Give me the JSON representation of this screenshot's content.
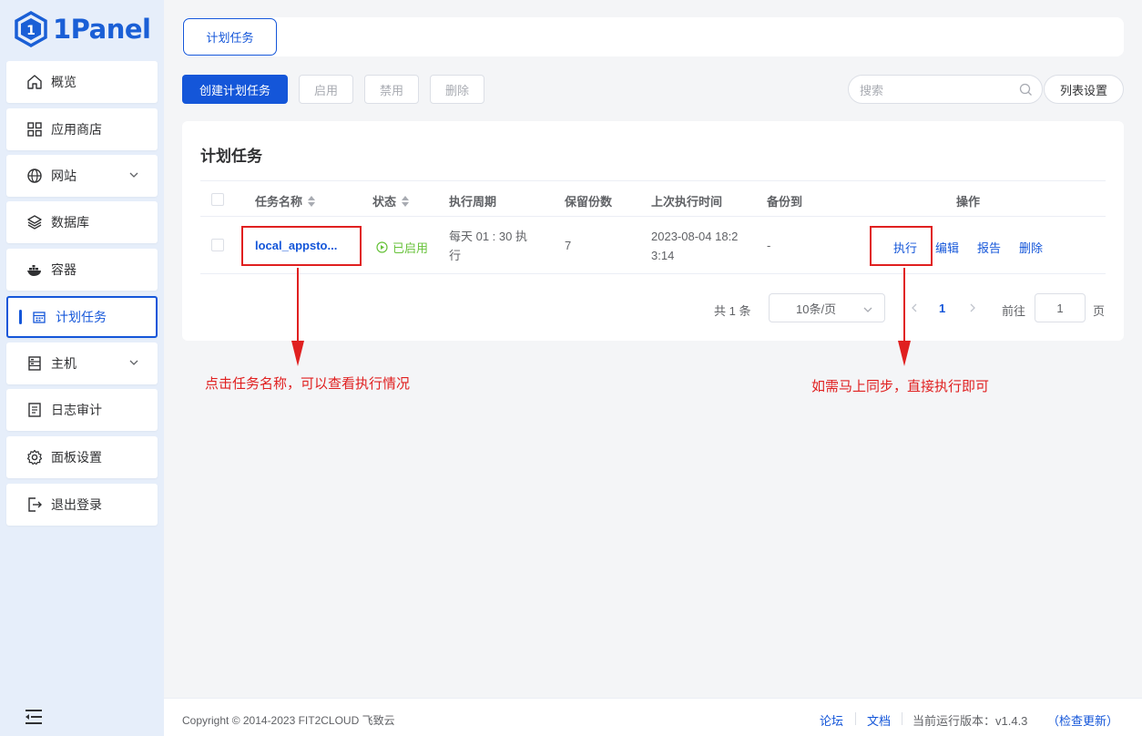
{
  "app": {
    "logo_text": "1Panel",
    "accent": "#1456d9",
    "annotation_color": "#e02020"
  },
  "sidebar": {
    "items": [
      {
        "label": "概览",
        "icon": "home-icon"
      },
      {
        "label": "应用商店",
        "icon": "grid-icon"
      },
      {
        "label": "网站",
        "icon": "globe-icon",
        "expandable": true
      },
      {
        "label": "数据库",
        "icon": "layers-icon"
      },
      {
        "label": "容器",
        "icon": "docker-icon"
      },
      {
        "label": "计划任务",
        "icon": "calendar-icon",
        "active": true
      },
      {
        "label": "主机",
        "icon": "server-icon",
        "expandable": true
      },
      {
        "label": "日志审计",
        "icon": "log-icon"
      },
      {
        "label": "面板设置",
        "icon": "gear-icon"
      },
      {
        "label": "退出登录",
        "icon": "logout-icon"
      }
    ]
  },
  "tabs": [
    {
      "label": "计划任务"
    }
  ],
  "toolbar": {
    "create": "创建计划任务",
    "enable": "启用",
    "disable": "禁用",
    "delete": "删除",
    "search_placeholder": "搜索",
    "list_settings": "列表设置"
  },
  "card": {
    "title": "计划任务"
  },
  "table": {
    "columns": [
      "任务名称",
      "状态",
      "执行周期",
      "保留份数",
      "上次执行时间",
      "备份到",
      "操作"
    ],
    "rows": [
      {
        "name": "local_appsto...",
        "status": "已启用",
        "cycle_line1": "每天  01 : 30 执",
        "cycle_line2": "行",
        "retain": "7",
        "last_run_line1": "2023-08-04 18:2",
        "last_run_line2": "3:14",
        "backup_to": "-",
        "actions": {
          "run": "执行",
          "edit": "编辑",
          "report": "报告",
          "delete": "删除"
        }
      }
    ]
  },
  "pagination": {
    "total": "共 1 条",
    "page_size": "10条/页",
    "current": "1",
    "goto_label": "前往",
    "goto_value": "1",
    "goto_unit": "页"
  },
  "annotations": {
    "left": "点击任务名称，可以查看执行情况",
    "right": "如需马上同步，直接执行即可"
  },
  "footer": {
    "copyright": "Copyright © 2014-2023 FIT2CLOUD 飞致云",
    "forum": "论坛",
    "docs": "文档",
    "version": "当前运行版本：v1.4.3",
    "check_update": "（检查更新）"
  }
}
